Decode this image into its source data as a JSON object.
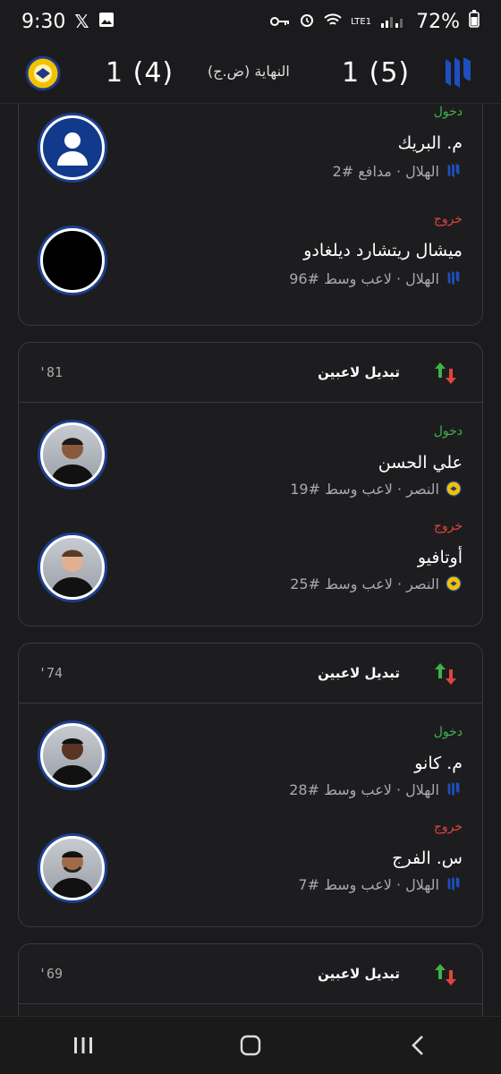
{
  "status_bar": {
    "time": "9:30",
    "battery": "72%",
    "network": "LTE1"
  },
  "header": {
    "home_score": "1 (5)",
    "away_score": "1 (4)",
    "status": "النهاية (ض.ج)"
  },
  "card1": {
    "in": {
      "tag": "دخول",
      "name": "م. البريك",
      "info": "الهلال · مدافع #2"
    },
    "out": {
      "tag": "خروج",
      "name": "ميشال ريتشارد ديلغادو",
      "info": "الهلال · لاعب وسط #96"
    }
  },
  "card2": {
    "minute": "'81",
    "title": "تبديل لاعبين",
    "in": {
      "tag": "دخول",
      "name": "علي الحسن",
      "info": "النصر · لاعب وسط #19"
    },
    "out": {
      "tag": "خروج",
      "name": "أوتافيو",
      "info": "النصر · لاعب وسط #25"
    }
  },
  "card3": {
    "minute": "'74",
    "title": "تبديل لاعبين",
    "in": {
      "tag": "دخول",
      "name": "م. كانو",
      "info": "الهلال · لاعب وسط #28"
    },
    "out": {
      "tag": "خروج",
      "name": "س. الفرج",
      "info": "الهلال · لاعب وسط #7"
    }
  },
  "card4": {
    "minute": "'69",
    "title": "تبديل لاعبين"
  },
  "colors": {
    "in": "#3fb24a",
    "out": "#e0453c",
    "hilal": "#1e4fc1",
    "nassr": "#f2c200"
  },
  "icons": {
    "nav_recent": "recent-apps-icon",
    "nav_home": "home-icon",
    "nav_back": "back-icon"
  }
}
